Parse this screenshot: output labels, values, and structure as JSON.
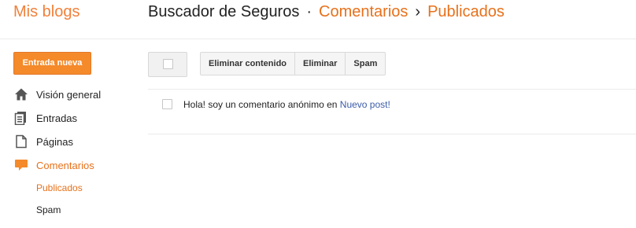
{
  "header": {
    "brand": "Mis blogs",
    "blog_title": "Buscador de Seguros",
    "separator_dot": "·",
    "section": "Comentarios",
    "separator_arrow": "›",
    "subsection": "Publicados"
  },
  "sidebar": {
    "new_post_label": "Entrada nueva",
    "items": [
      {
        "label": "Visión general",
        "icon": "home-icon"
      },
      {
        "label": "Entradas",
        "icon": "posts-icon"
      },
      {
        "label": "Páginas",
        "icon": "page-icon"
      },
      {
        "label": "Comentarios",
        "icon": "comment-icon"
      }
    ],
    "sub_items": [
      {
        "label": "Publicados"
      },
      {
        "label": "Spam"
      }
    ]
  },
  "toolbar": {
    "delete_content_label": "Eliminar contenido",
    "delete_label": "Eliminar",
    "spam_label": "Spam"
  },
  "comments": [
    {
      "text": "Hola! soy un comentario anónimo en ",
      "post_title": "Nuevo post!"
    }
  ],
  "colors": {
    "accent": "#e7711b",
    "button_orange": "#f48a2a",
    "link_blue": "#3b5ca8"
  }
}
